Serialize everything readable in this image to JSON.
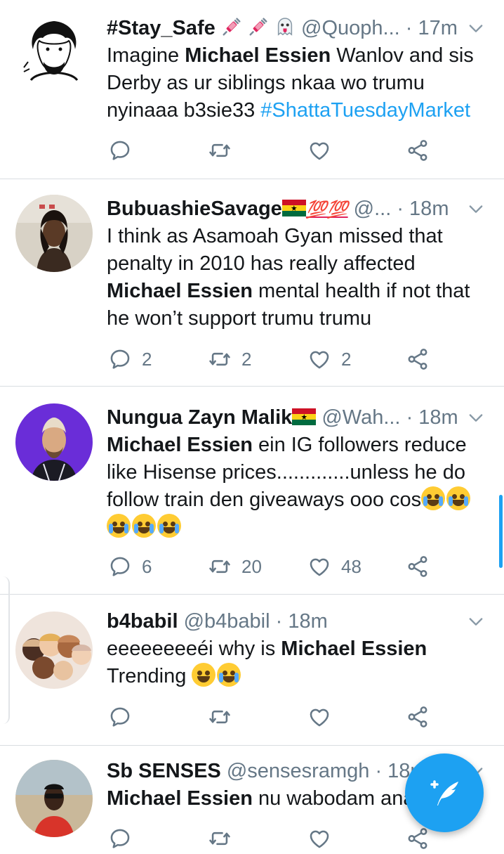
{
  "tweets": [
    {
      "name": "#Stay_Safe",
      "handle": "@Quoph...",
      "time": "· 17m",
      "body": {
        "p1": "Imagine ",
        "bold": "Michael Essien",
        "p2": " Wanlov and sis Derby as ur siblings nkaa wo trumu nyinaaa b3sie33 ",
        "hashtag": "#ShattaTuesdayMarket"
      },
      "replies": "",
      "retweets": "",
      "likes": ""
    },
    {
      "name": "BubuashieSavage",
      "name_extra": "💯💯",
      "handle": "@...",
      "time": "· 18m",
      "body": {
        "p1": "I think as Asamoah Gyan missed that penalty in 2010 has really affected ",
        "bold": "Michael Essien",
        "p2": " mental health if not that he won’t support trumu trumu"
      },
      "replies": "2",
      "retweets": "2",
      "likes": "2"
    },
    {
      "name": "Nungua Zayn Malik",
      "handle": "@Wah...",
      "time": "· 18m",
      "body": {
        "bold": "Michael Essien",
        "p2": " ein IG followers reduce like Hisense prices.............unless he do follow train den giveaways ooo cos"
      },
      "replies": "6",
      "retweets": "20",
      "likes": "48"
    },
    {
      "name": "b4babil",
      "handle": "@b4babil",
      "time": "· 18m",
      "body": {
        "p1": "eeeeeeeeéi why is ",
        "bold": "Michael Essien",
        "p2": " Trending "
      },
      "replies": "",
      "retweets": "",
      "likes": ""
    },
    {
      "name": "Sb SENSES",
      "handle": "@sensesramgh",
      "time": "· 18m",
      "body": {
        "bold": "Michael Essien",
        "p2": " nu wabodam ana"
      },
      "replies": "",
      "retweets": "",
      "likes": ""
    }
  ],
  "icons": {
    "reply": "reply-icon",
    "retweet": "retweet-icon",
    "like": "heart-icon",
    "share": "share-icon",
    "caret": "chevron-down-icon",
    "compose": "compose-tweet-icon"
  },
  "colors": {
    "accent": "#1da1f2",
    "text": "#14171a",
    "secondary": "#657786",
    "divider": "#d9dde1"
  }
}
